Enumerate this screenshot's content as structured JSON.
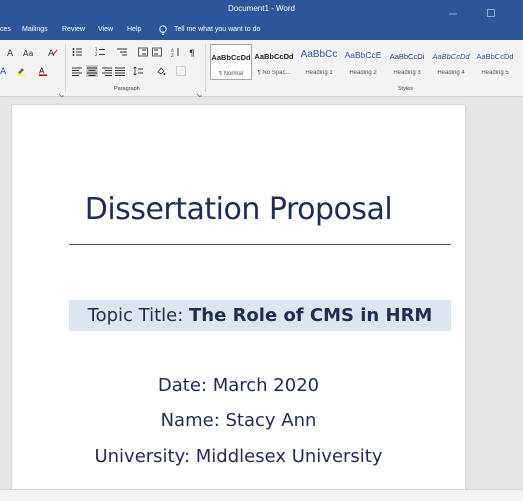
{
  "window": {
    "title": "Document1 - Word"
  },
  "menu": {
    "items": [
      "ces",
      "Mailings",
      "Review",
      "View",
      "Help"
    ],
    "tell_me": "Tell me what you want to do"
  },
  "ribbon": {
    "paragraph_label": "Paragraph",
    "styles_label": "Styles",
    "styles": [
      {
        "sample": "AaBbCcDd",
        "name": "¶ Normal"
      },
      {
        "sample": "AaBbCcDd",
        "name": "¶ No Spac..."
      },
      {
        "sample": "AaBbCc",
        "name": "Heading 1"
      },
      {
        "sample": "AaBbCcE",
        "name": "Heading 2"
      },
      {
        "sample": "AaBbCcDi",
        "name": "Heading 3"
      },
      {
        "sample": "AaBbCcDd",
        "name": "Heading 4"
      },
      {
        "sample": "AaBbCcDd",
        "name": "Heading 5"
      }
    ],
    "colors": {
      "ribbon_blue": "#2b579a",
      "highlight": "#ffff00",
      "font_color": "#c00000"
    }
  },
  "document": {
    "title": "Dissertation Proposal",
    "topic_label": "Topic Title: ",
    "topic_value": "The Role of CMS in HRM",
    "date": "Date: March 2020",
    "name": "Name: Stacy Ann",
    "university": "University: Middlesex University"
  }
}
